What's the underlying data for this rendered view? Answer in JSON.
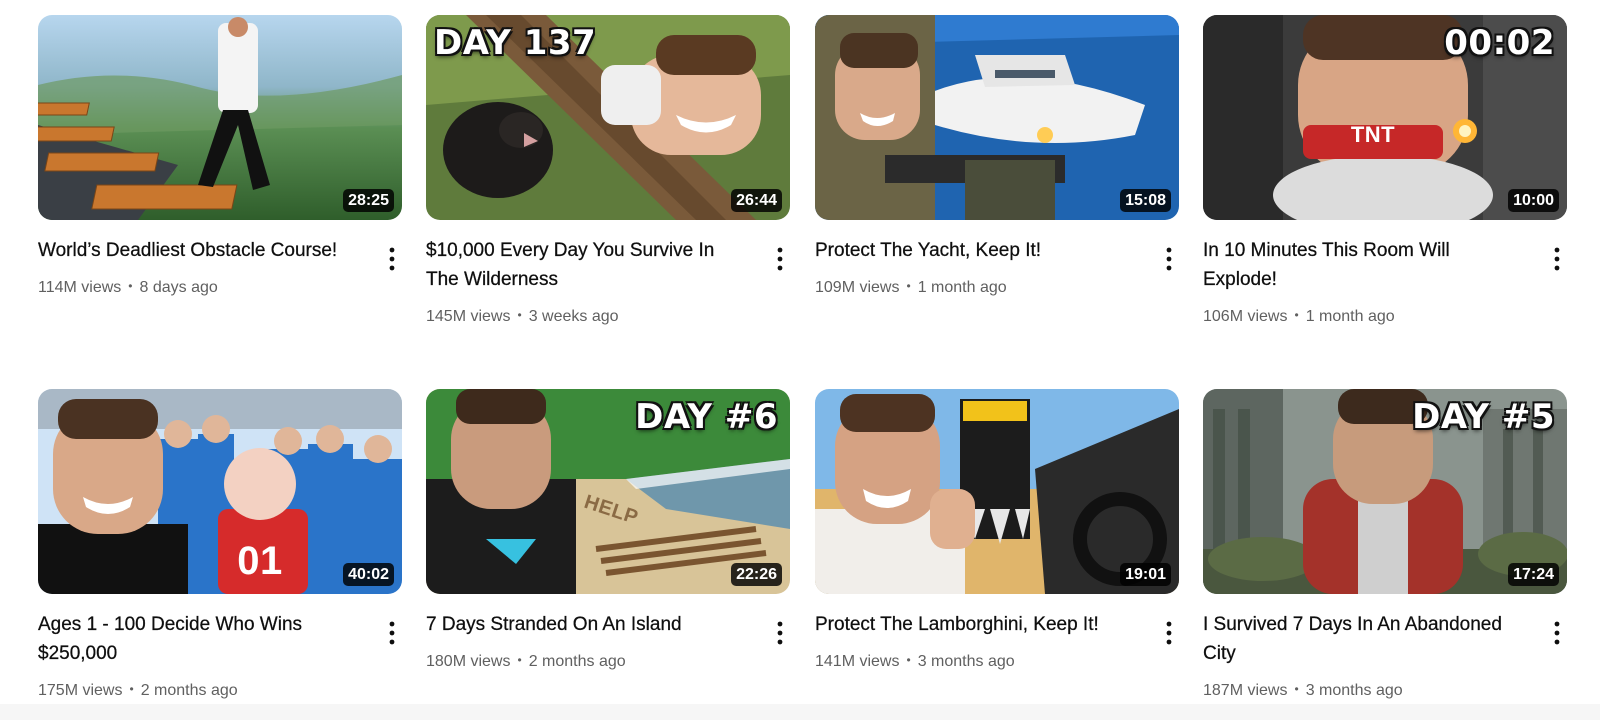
{
  "videos": [
    {
      "title": "World’s Deadliest Obstacle Course!",
      "views": "114M views",
      "age": "8 days ago",
      "duration": "28:25",
      "thumb_text": "",
      "thumb_colors": [
        "#9fc7e6",
        "#4f8f4a",
        "#2e5c2a"
      ]
    },
    {
      "title": "$10,000 Every Day You Survive In The Wilderness",
      "views": "145M views",
      "age": "3 weeks ago",
      "duration": "26:44",
      "thumb_text": "DAY 137",
      "thumb_colors": [
        "#5c7a3a",
        "#8a6a42",
        "#3e4f2a"
      ]
    },
    {
      "title": "Protect The Yacht, Keep It!",
      "views": "109M views",
      "age": "1 month ago",
      "duration": "15:08",
      "thumb_text": "",
      "thumb_colors": [
        "#1d5fa8",
        "#3a83cf",
        "#5a5a44"
      ]
    },
    {
      "title": "In 10 Minutes This Room Will Explode!",
      "views": "106M views",
      "age": "1 month ago",
      "duration": "10:00",
      "thumb_text": "00:02",
      "thumb_colors": [
        "#3a3a3a",
        "#6b6b6b",
        "#c22a2a"
      ]
    },
    {
      "title": "Ages 1 - 100 Decide Who Wins $250,000",
      "views": "175M views",
      "age": "2 months ago",
      "duration": "40:02",
      "thumb_text": "",
      "thumb_colors": [
        "#2a74c9",
        "#cfe3f6",
        "#d62b2b"
      ]
    },
    {
      "title": "7 Days Stranded On An Island",
      "views": "180M views",
      "age": "2 months ago",
      "duration": "22:26",
      "thumb_text": "DAY #6",
      "thumb_colors": [
        "#d9c59a",
        "#3f8a3a",
        "#6f8fa3"
      ]
    },
    {
      "title": "Protect The Lamborghini, Keep It!",
      "views": "141M views",
      "age": "3 months ago",
      "duration": "19:01",
      "thumb_text": "",
      "thumb_colors": [
        "#7fb8e8",
        "#e0b56b",
        "#2b2b2b"
      ]
    },
    {
      "title": "I Survived 7 Days In An Abandoned City",
      "views": "187M views",
      "age": "3 months ago",
      "duration": "17:24",
      "thumb_text": "DAY #5",
      "thumb_colors": [
        "#7d8a83",
        "#4f5a4f",
        "#a4322a"
      ]
    }
  ],
  "thumb_labels": {
    "tnt": "TNT",
    "jersey": "01",
    "sand": "HELP"
  },
  "icons": {
    "more": "more-vert-icon"
  }
}
